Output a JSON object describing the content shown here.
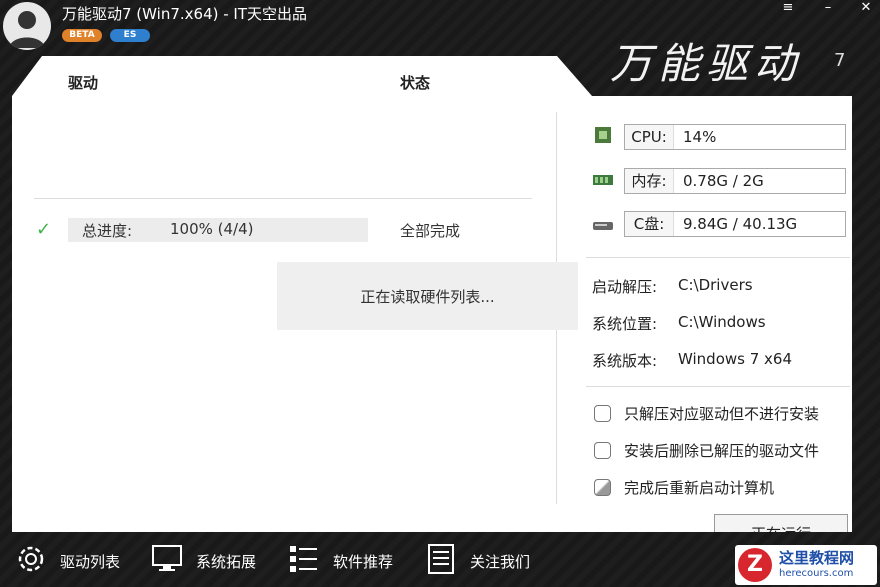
{
  "window": {
    "title": "万能驱动7 (Win7.x64) - IT天空出品",
    "badges": [
      "BETA",
      "ES"
    ],
    "controls": [
      "≡",
      "–",
      "✕"
    ],
    "brand": "万能驱动",
    "brand_version": "7"
  },
  "driver_list": {
    "col_driver": "驱动",
    "col_status": "状态",
    "progress_label": "总进度:",
    "progress_value": "100% (4/4)",
    "progress_status": "全部完成",
    "loading_text": "正在读取硬件列表..."
  },
  "stats": {
    "cpu_label": "CPU:",
    "cpu_value": "14%",
    "mem_label": "内存:",
    "mem_value": "0.78G / 2G",
    "disk_label": "C盘:",
    "disk_value": "9.84G / 40.13G"
  },
  "info": {
    "extract_label": "启动解压:",
    "extract_value": "C:\\Drivers",
    "sys_label": "系统位置:",
    "sys_value": "C:\\Windows",
    "ver_label": "系统版本:",
    "ver_value": "Windows 7 x64"
  },
  "options": {
    "opt1": "只解压对应驱动但不进行安装",
    "opt2": "安装后删除已解压的驱动文件",
    "opt3": "完成后重新启动计算机"
  },
  "run_button": "正在运行",
  "nav": {
    "drivers": "驱动列表",
    "expand": "系统拓展",
    "software": "软件推荐",
    "about": "关注我们"
  },
  "watermark": {
    "logo": "Z",
    "cn": "这里教程网",
    "en": "herecours.com"
  },
  "colors": {
    "frame": "#1e1e1e",
    "panel": "#ffffff",
    "check": "#3cb44b",
    "beta": "#e0822a",
    "es": "#2f7fcf"
  }
}
